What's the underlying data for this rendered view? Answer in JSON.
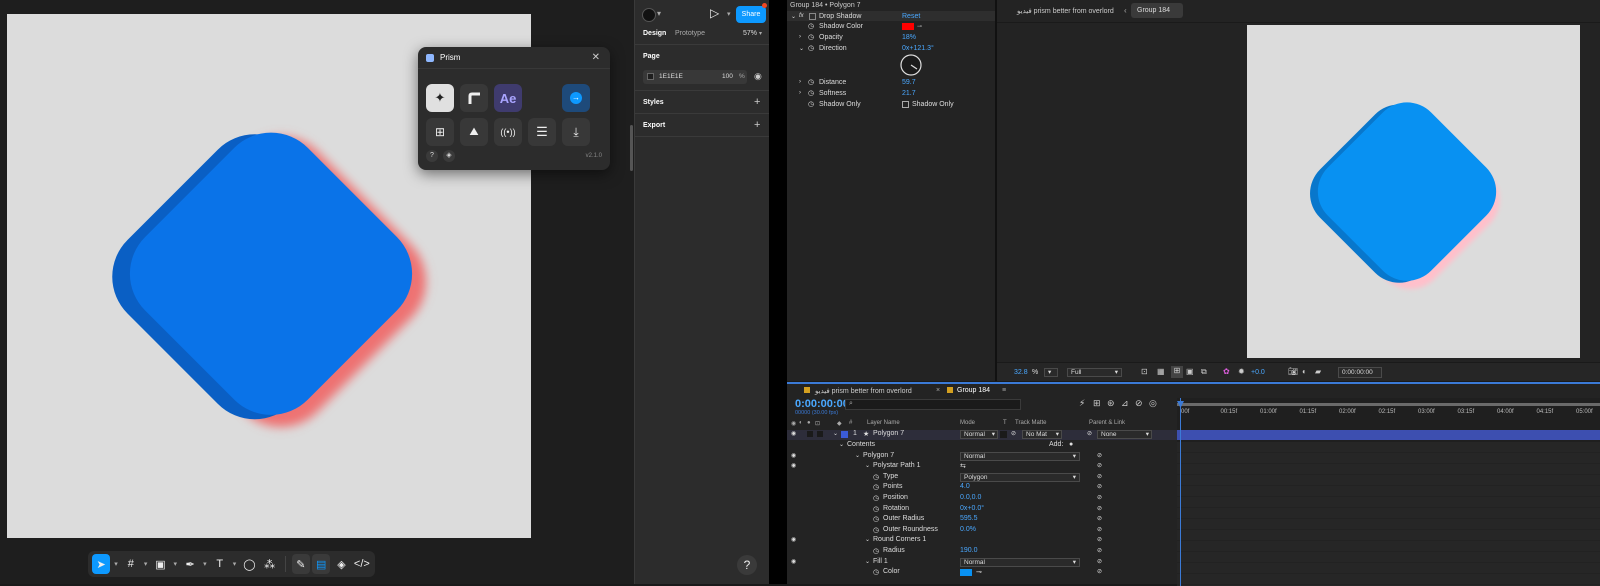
{
  "figma": {
    "toolbar": {
      "tools": [
        "move-tool",
        "frame-tool",
        "shape-tool",
        "pen-tool",
        "text-tool",
        "comment-tool",
        "actions-tool"
      ]
    },
    "help_label": "?",
    "plugin": {
      "title": "Prism",
      "ae_label": "Ae",
      "version": "v2.1.0",
      "help_label": "?"
    },
    "panel": {
      "tabs": [
        "Design",
        "Prototype"
      ],
      "zoom": "57%",
      "share_label": "Share",
      "page_heading": "Page",
      "page_color": "1E1E1E",
      "page_opacity": "100",
      "percent": "%",
      "styles_heading": "Styles",
      "export_heading": "Export"
    }
  },
  "effects": {
    "title": "Group 184 • Polygon 7",
    "rows": [
      {
        "label": "Drop Shadow",
        "value": "Reset"
      },
      {
        "label": "Shadow Color",
        "value": ""
      },
      {
        "label": "Opacity",
        "value": "18%"
      },
      {
        "label": "Direction",
        "value": "0x+121.3°"
      },
      {
        "label": "Distance",
        "value": "59.7"
      },
      {
        "label": "Softness",
        "value": "21.7"
      },
      {
        "label": "Shadow Only",
        "value": "Shadow Only"
      }
    ],
    "fx_label": "fx",
    "shadow_color": "#ff0000"
  },
  "viewer": {
    "tab_main": "فيديو prism better from overlord",
    "tab_group": "Group 184",
    "zoom": "32.8",
    "zoom_unit": "%",
    "resolution": "Full",
    "offset": "+0.0",
    "timecode": "0:00:00:00"
  },
  "timeline": {
    "tabs": [
      "فيديو prism better from overlord",
      "Group 184"
    ],
    "timecode": "0:00:00:00",
    "fps_info": "00000 (30.00 fps)",
    "search_placeholder": "",
    "col_layer": "Layer Name",
    "col_mode": "Mode",
    "col_t": "T",
    "col_trackmatte": "Track Matte",
    "col_parent": "Parent & Link",
    "layer_num": "1",
    "layer_name": "Polygon 7",
    "layer_mode": "Normal",
    "layer_matte": "No Mat",
    "layer_parent": "None",
    "props": [
      {
        "label": "Contents",
        "value": "",
        "extra": "Add:"
      },
      {
        "label": "Polygon 7",
        "value": "Normal"
      },
      {
        "label": "Polystar Path 1",
        "value": ""
      },
      {
        "label": "Type",
        "value": "Polygon"
      },
      {
        "label": "Points",
        "value": "4.0"
      },
      {
        "label": "Position",
        "value": "0.0,0.0"
      },
      {
        "label": "Rotation",
        "value": "0x+0.0°"
      },
      {
        "label": "Outer Radius",
        "value": "595.5"
      },
      {
        "label": "Outer Roundness",
        "value": "0.0%"
      },
      {
        "label": "Round Corners 1",
        "value": ""
      },
      {
        "label": "Radius",
        "value": "190.0"
      },
      {
        "label": "Fill 1",
        "value": "Normal"
      },
      {
        "label": "Color",
        "value": ""
      }
    ],
    "ticks": [
      "00f",
      "00:15f",
      "01:00f",
      "01:15f",
      "02:00f",
      "02:15f",
      "03:00f",
      "03:15f",
      "04:00f",
      "04:15f",
      "05:00f"
    ]
  },
  "colors": {
    "accent": "#0d99ff",
    "shape_blue": "#0a73e8",
    "shape_dark": "#0a5fc4",
    "shadow_red": "#f08080",
    "comp_blue": "#0891f2",
    "comp_shadow": "#ffc0cb"
  }
}
